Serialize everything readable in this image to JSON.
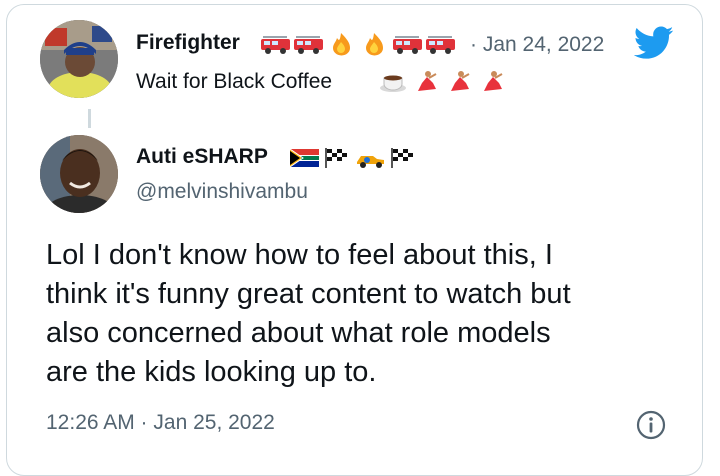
{
  "parent_tweet": {
    "display_name": "Firefighter",
    "name_emojis": [
      "fire-engine-icon",
      "fire-engine-icon",
      "fire-icon",
      "fire-icon",
      "fire-engine-icon",
      "fire-engine-icon"
    ],
    "separator": "·",
    "date": "Jan 24, 2022",
    "bio_text": "Wait for Black Coffee",
    "bio_emojis": [
      "coffee-icon",
      "dancer-icon",
      "dancer-icon",
      "dancer-icon"
    ]
  },
  "reply_tweet": {
    "display_name": "Auti eSHARP",
    "name_emojis": [
      "south-africa-flag-icon",
      "checkered-flag-icon",
      "race-car-icon",
      "checkered-flag-icon"
    ],
    "handle": "@melvinshivambu",
    "body_lines": [
      "Lol I don't know how to feel about this, I",
      "think it's funny great content to watch but",
      "also concerned about what role models",
      "are the kids looking up to."
    ],
    "timestamp": "12:26 AM · Jan 25, 2022"
  },
  "colors": {
    "text": "#0f1419",
    "secondary": "#536471",
    "twitter_blue": "#1d9bf0",
    "border": "#cfd9de"
  },
  "icons": {
    "brand": "twitter-bird-icon",
    "info": "info-icon"
  }
}
